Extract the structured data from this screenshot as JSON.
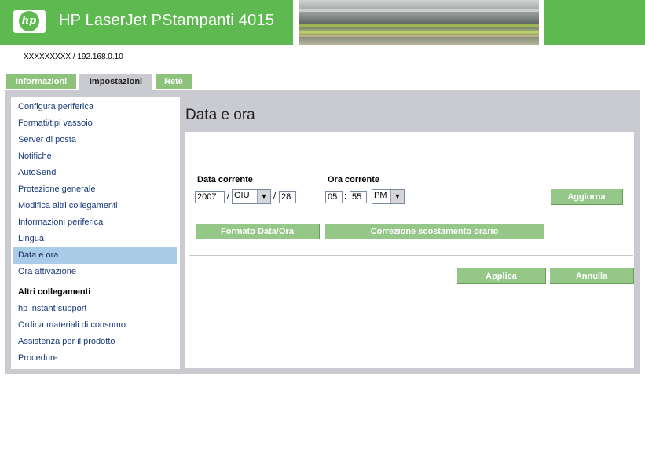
{
  "header": {
    "logo_text": "hp",
    "title": "HP LaserJet PStampanti 4015"
  },
  "address": "XXXXXXXXX / 192.168.0.10",
  "tabs": [
    {
      "label": "Informazioni"
    },
    {
      "label": "Impostazioni"
    },
    {
      "label": "Rete"
    }
  ],
  "sidebar": {
    "items": [
      {
        "label": "Configura periferica"
      },
      {
        "label": "Formati/tipi vassoio"
      },
      {
        "label": "Server di posta"
      },
      {
        "label": "Notifiche"
      },
      {
        "label": "AutoSend"
      },
      {
        "label": "Protezione generale"
      },
      {
        "label": "Modifica altri collegamenti"
      },
      {
        "label": "Informazioni periferica"
      },
      {
        "label": "Lingua"
      },
      {
        "label": "Data e ora"
      },
      {
        "label": "Ora attivazione"
      }
    ],
    "other_heading": "Altri collegamenti",
    "other_links": [
      {
        "label": "hp instant support"
      },
      {
        "label": "Ordina materiali di consumo"
      },
      {
        "label": "Assistenza per il prodotto"
      },
      {
        "label": "Procedure"
      }
    ]
  },
  "main": {
    "title": "Data e ora",
    "date_label": "Data corrente",
    "time_label": "Ora corrente",
    "year": "2007",
    "month": "GIU",
    "day": "28",
    "hour": "05",
    "minute": "55",
    "ampm": "PM",
    "date_sep": "/",
    "time_sep": ":",
    "refresh_button": "Aggiorna",
    "date_format_button": "Formato Data/Ora",
    "offset_button": "Correzione scostamento orario",
    "apply_button": "Applica",
    "cancel_button": "Annulla"
  },
  "colors": {
    "brand_green": "#5fb951",
    "button_green": "#95c888",
    "selected_nav": "#a9cde9",
    "panel_gray": "#c9cbd0"
  }
}
